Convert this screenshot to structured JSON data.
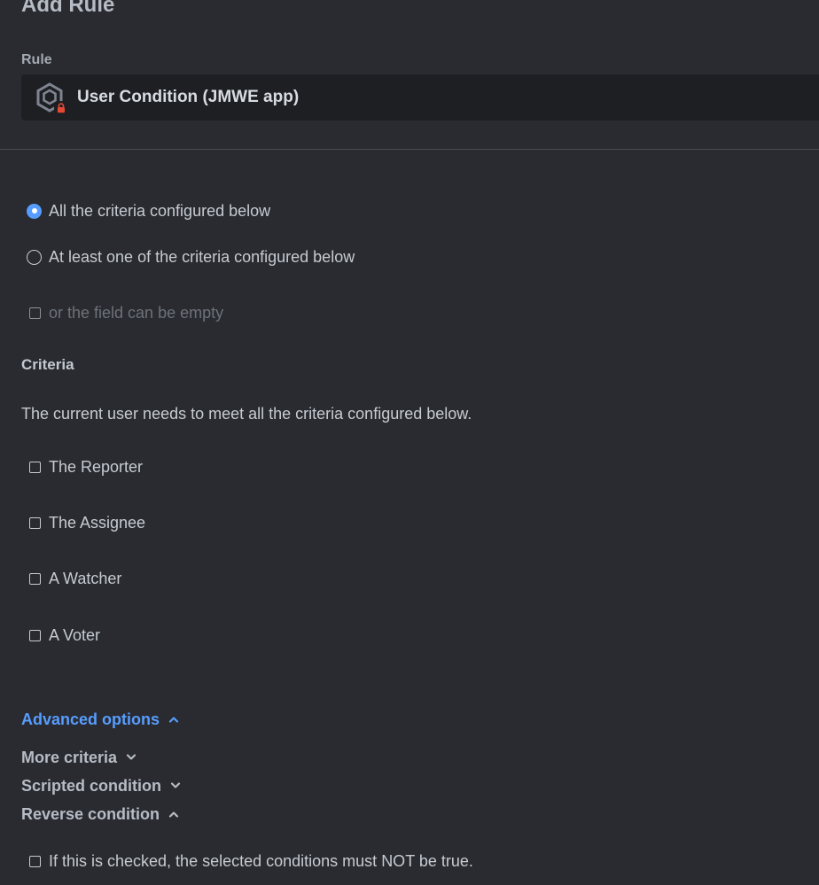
{
  "dialog": {
    "title": "Add Rule"
  },
  "rule": {
    "label": "Rule",
    "value": "User Condition (JMWE app)",
    "icon": "hexagon-gear-icon",
    "badge_icon": "lock-icon"
  },
  "match_mode": {
    "selected": "all",
    "options": [
      {
        "id": "all",
        "label": "All the criteria configured below",
        "checked": true
      },
      {
        "id": "any",
        "label": "At least one of the criteria configured below",
        "checked": false
      }
    ]
  },
  "empty_option": {
    "label": "or the field can be empty",
    "checked": false,
    "disabled": true
  },
  "criteria": {
    "heading": "Criteria",
    "description": "The current user needs to meet all the criteria configured below.",
    "items": [
      {
        "label": "The Reporter",
        "checked": false
      },
      {
        "label": "The Assignee",
        "checked": false
      },
      {
        "label": "A Watcher",
        "checked": false
      },
      {
        "label": "A Voter",
        "checked": false
      }
    ]
  },
  "advanced": {
    "link_label": "Advanced options",
    "expanded": true,
    "sections": [
      {
        "label": "More criteria",
        "expanded": false
      },
      {
        "label": "Scripted condition",
        "expanded": false
      },
      {
        "label": "Reverse condition",
        "expanded": true
      }
    ],
    "reverse_checkbox": {
      "label": "If this is checked, the selected conditions must NOT be true.",
      "checked": false
    }
  },
  "colors": {
    "background": "#2a2b30",
    "field_background": "#1e1f22",
    "accent": "#579dff",
    "lock_badge": "#e34935"
  }
}
